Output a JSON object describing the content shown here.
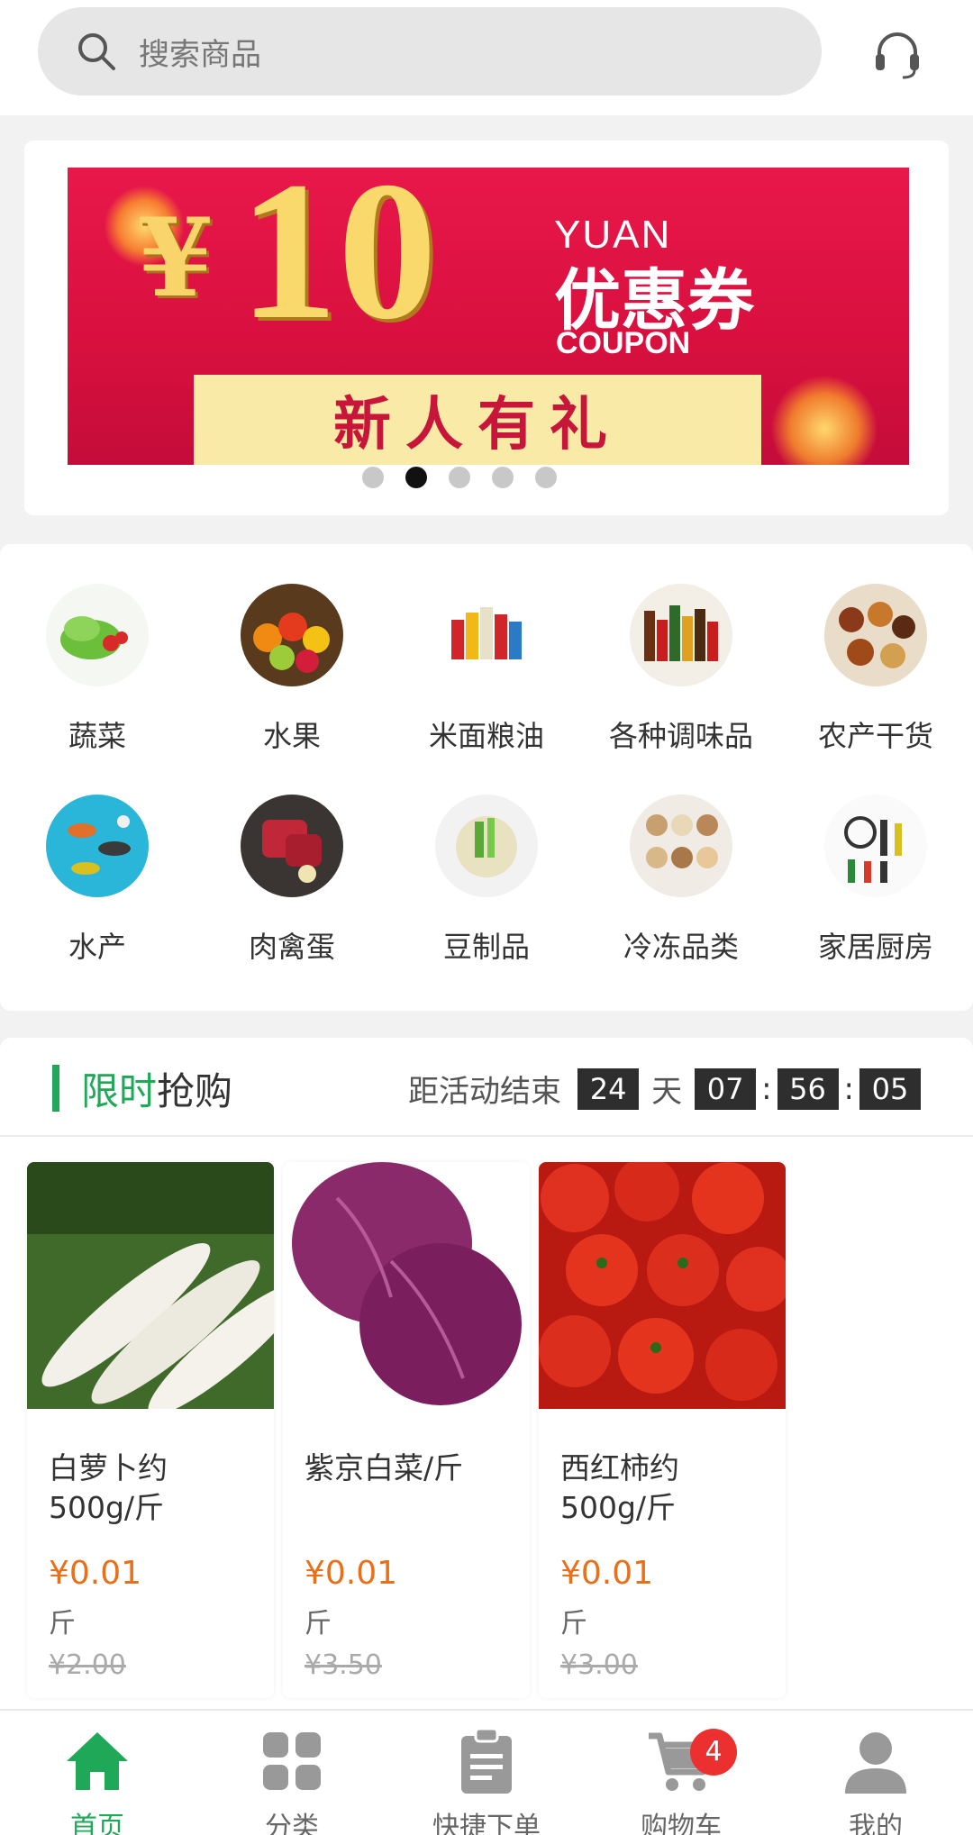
{
  "search": {
    "placeholder": "搜索商品"
  },
  "banner": {
    "symbol": "¥",
    "amount": "10",
    "yuan": "YUAN",
    "coupon_cn": "优惠券",
    "coupon_en": "COUPON",
    "strip": "新人有礼",
    "slide_count": 5,
    "active_slide": 2
  },
  "categories": [
    {
      "label": "蔬菜",
      "icon": "vegetables-image"
    },
    {
      "label": "水果",
      "icon": "fruits-image"
    },
    {
      "label": "米面粮油",
      "icon": "grain-oil-image"
    },
    {
      "label": "各种调味品",
      "icon": "condiments-image"
    },
    {
      "label": "农产干货",
      "icon": "dried-goods-image"
    },
    {
      "label": "水产",
      "icon": "seafood-image"
    },
    {
      "label": "肉禽蛋",
      "icon": "meat-image"
    },
    {
      "label": "豆制品",
      "icon": "soy-products-image"
    },
    {
      "label": "冷冻品类",
      "icon": "frozen-image"
    },
    {
      "label": "家居厨房",
      "icon": "kitchen-image"
    }
  ],
  "flash": {
    "title_green": "限时",
    "title_rest": "抢购",
    "countdown_label": "距活动结束",
    "days": "24",
    "day_unit": "天",
    "hours": "07",
    "minutes": "56",
    "seconds": "05"
  },
  "products": [
    {
      "name": "白萝卜约500g/斤",
      "price": "¥0.01",
      "unit": "斤",
      "original": "¥2.00",
      "image": "white-radish-image"
    },
    {
      "name": "紫京白菜/斤",
      "price": "¥0.01",
      "unit": "斤",
      "original": "¥3.50",
      "image": "purple-cabbage-image"
    },
    {
      "name": "西红柿约500g/斤",
      "price": "¥0.01",
      "unit": "斤",
      "original": "¥3.00",
      "image": "tomato-image"
    }
  ],
  "tabs": [
    {
      "label": "首页",
      "icon": "home-icon"
    },
    {
      "label": "分类",
      "icon": "grid-icon"
    },
    {
      "label": "快捷下单",
      "icon": "clipboard-icon"
    },
    {
      "label": "购物车",
      "icon": "cart-icon"
    },
    {
      "label": "我的",
      "icon": "user-icon"
    }
  ],
  "cart_badge": "4",
  "colors": {
    "accent": "#1fa858",
    "price": "#e8701a",
    "badge": "#ec3030"
  }
}
